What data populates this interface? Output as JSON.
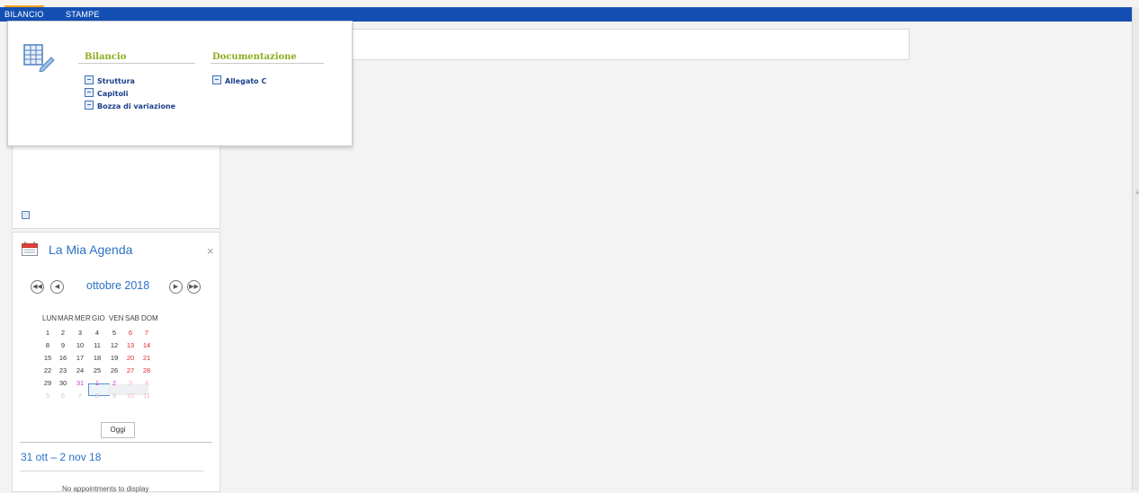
{
  "menubar": {
    "tabs": [
      {
        "label": "BILANCIO"
      },
      {
        "label": "STAMPE"
      }
    ]
  },
  "dropdown": {
    "sections": [
      {
        "heading": "Bilancio",
        "items": [
          "Struttura",
          "Capitoli",
          "Bozza di variazione"
        ]
      },
      {
        "heading": "Documentazione",
        "items": [
          "Allegato C"
        ]
      }
    ]
  },
  "agenda": {
    "title": "La Mia Agenda",
    "close": "×",
    "month": "ottobre 2018",
    "weekdays": [
      "LUN",
      "MAR",
      "MER",
      "GIO",
      "VEN",
      "SAB",
      "DOM"
    ],
    "weeks": [
      [
        "1",
        "2",
        "3",
        "4",
        "5",
        "6",
        "7"
      ],
      [
        "8",
        "9",
        "10",
        "11",
        "12",
        "13",
        "14"
      ],
      [
        "15",
        "16",
        "17",
        "18",
        "19",
        "20",
        "21"
      ],
      [
        "22",
        "23",
        "24",
        "25",
        "26",
        "27",
        "28"
      ],
      [
        "29",
        "30",
        "31",
        "1",
        "2",
        "3",
        "4"
      ],
      [
        "5",
        "6",
        "7",
        "8",
        "9",
        "10",
        "11"
      ]
    ],
    "today_button": "Oggi",
    "range": "31 ott – 2 nov 18",
    "empty_message": "No appointments to display"
  },
  "colors": {
    "topbar": "#1450b4",
    "accent": "#2a72c3",
    "section_heading": "#8bae1d",
    "weekend": "#e0262b"
  }
}
